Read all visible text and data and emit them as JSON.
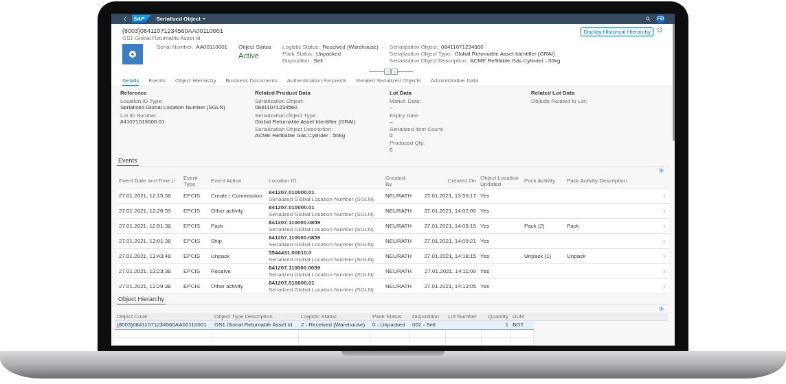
{
  "shell": {
    "logo": "SAP",
    "title": "Serialized Object",
    "avatar": "FD"
  },
  "header": {
    "title": "(8003)08411071234560AA00110001",
    "subtitle": "GS1 Global Returnable Asset Id",
    "action": "Display Historical Hierarchy",
    "groups": [
      {
        "kind": "fields",
        "fields": [
          {
            "label": "Serial Number:",
            "value": "AA00110001"
          }
        ]
      },
      {
        "kind": "status",
        "label": "Object Status",
        "value": "Active"
      },
      {
        "kind": "fields",
        "fields": [
          {
            "label": "Logistic Status:",
            "value": "Received (Warehouse)"
          },
          {
            "label": "Pack Status:",
            "value": "Unpacked"
          },
          {
            "label": "Disposition:",
            "value": "Sell"
          }
        ]
      },
      {
        "kind": "fields",
        "fields": [
          {
            "label": "Serialization Object:",
            "value": "08411071234560"
          },
          {
            "label": "Serialization Object Type:",
            "value": "Global Returnable Asset Identifier (GRAI)"
          },
          {
            "label": "Serialization Object Description:",
            "value": "ACME Refillable Gas Cylinder - 50kg"
          }
        ]
      }
    ]
  },
  "tabs": [
    {
      "label": "Details",
      "selected": true
    },
    {
      "label": "Events",
      "selected": false
    },
    {
      "label": "Object Hierarchy",
      "selected": false
    },
    {
      "label": "Business Documents",
      "selected": false
    },
    {
      "label": "Authentication Requests",
      "selected": false
    },
    {
      "label": "Related Serialized Objects",
      "selected": false
    },
    {
      "label": "Administrative Data",
      "selected": false
    }
  ],
  "details": [
    {
      "title": "Reference",
      "fields": [
        {
          "label": "Location ID Type:",
          "value": "Serialized Global Location Number (SGLN)"
        },
        {
          "label": "Lot ID Number:",
          "value": "841071019000.01"
        }
      ]
    },
    {
      "title": "Related Product Data",
      "fields": [
        {
          "label": "Serialization Object:",
          "value": "08411071234560"
        },
        {
          "label": "Serialization Object Type:",
          "value": "Global Returnable Asset Identifier (GRAI)"
        },
        {
          "label": "Serialization Object Description:",
          "value": "ACME Refillable Gas Cylinder - 50kg"
        }
      ]
    },
    {
      "title": "Lot Data",
      "fields": [
        {
          "label": "Manuf. Date:",
          "value": "–"
        },
        {
          "label": "Expiry Date:",
          "value": "–"
        },
        {
          "label": "Serialized Item Count:",
          "value": "0"
        },
        {
          "label": "Produced Qty:",
          "value": "0"
        }
      ]
    },
    {
      "title": "Related Lot Data",
      "fields": [
        {
          "label": "Objects Related to Lot:"
        }
      ]
    }
  ],
  "events": {
    "title": "Events",
    "columns": [
      {
        "label": "Event Date and Time",
        "sorted": true
      },
      {
        "label": "Event Type",
        "sorted": false
      },
      {
        "label": "Event Action",
        "sorted": false
      },
      {
        "label": "Location ID",
        "sorted": false
      },
      {
        "label": "Created By",
        "sorted": false
      },
      {
        "label": "Created On",
        "sorted": false
      },
      {
        "label": "Object Location Updated",
        "sorted": false
      },
      {
        "label": "Pack Activity",
        "sorted": false
      },
      {
        "label": "Pack Activity Description",
        "sorted": false
      }
    ],
    "rows": [
      {
        "date": "27.01.2021, 12:15:38",
        "type": "EPCIS",
        "action": "Create / Commission",
        "location_id": "841207.010000.01",
        "location_type": "Serialized Global Location Number (SGLN)",
        "created_by": "NEURATH",
        "created_on": "27.01.2021, 13:59:17",
        "updated": "Yes"
      },
      {
        "date": "27.01.2021, 12:20:39",
        "type": "EPCIS",
        "action": "Other activity",
        "location_id": "841207.010000.01",
        "location_type": "Serialized Global Location Number (SGLN)",
        "created_by": "NEURATH",
        "created_on": "27.01.2021, 14:02:00",
        "updated": "Yes"
      },
      {
        "date": "27.01.2021, 12:51:38",
        "type": "EPCIS",
        "action": "Pack",
        "location_id": "841207.110000.0859",
        "location_type": "Serialized Global Location Number (SGLN)",
        "created_by": "NEURATH",
        "created_on": "27.01.2021, 14:05:15",
        "updated": "Yes",
        "pack_activity": "Pack (2)",
        "pack_description": "Pack"
      },
      {
        "date": "27.01.2021, 13:01:38",
        "type": "EPCIS",
        "action": "Ship",
        "location_id": "841207.110000.0859",
        "location_type": "Serialized Global Location Number (SGLN)",
        "created_by": "NEURATH",
        "created_on": "27.01.2021, 14:09:21",
        "updated": "Yes"
      },
      {
        "date": "27.01.2021, 13:43:48",
        "type": "EPCIS",
        "action": "Unpack",
        "location_id": "5544431.00010.0",
        "location_type": "Serialized Global Location Number (SGLN)",
        "created_by": "NEURATH",
        "created_on": "27.01.2021, 14:18:15",
        "updated": "Yes",
        "pack_activity": "Unpack (1)",
        "pack_description": "Unpack"
      },
      {
        "date": "27.01.2021, 13:23:38",
        "type": "EPCIS",
        "action": "Receive",
        "location_id": "841207.110000.0059",
        "location_type": "Serialized Global Location Number (SGLN)",
        "created_by": "NEURATH",
        "created_on": "27.01.2021, 14:11:09",
        "updated": "Yes"
      },
      {
        "date": "27.01.2021, 13:29:38",
        "type": "EPCIS",
        "action": "Other activity",
        "location_id": "841207.010000.01",
        "location_type": "Serialized Global Location Number (SGLN)",
        "created_by": "NEURATH",
        "created_on": "27.01.2021, 14:13:05",
        "updated": "Yes"
      }
    ]
  },
  "hierarchy": {
    "title": "Object Hierarchy",
    "columns": [
      "Object Code",
      "Object Type Description",
      "Logistic Status",
      "Pack Status",
      "Disposition",
      "Lot Number",
      "Quantity",
      "UoM"
    ],
    "rows": [
      {
        "selected": true,
        "cells": [
          "(8003)08411071234560AA00110001",
          "GS1 Global Returnable Asset Id",
          "2 - Received (Warehouse)",
          "0 - Unpacked",
          "002 - Sell",
          "",
          "1",
          "BOT"
        ]
      }
    ]
  }
}
